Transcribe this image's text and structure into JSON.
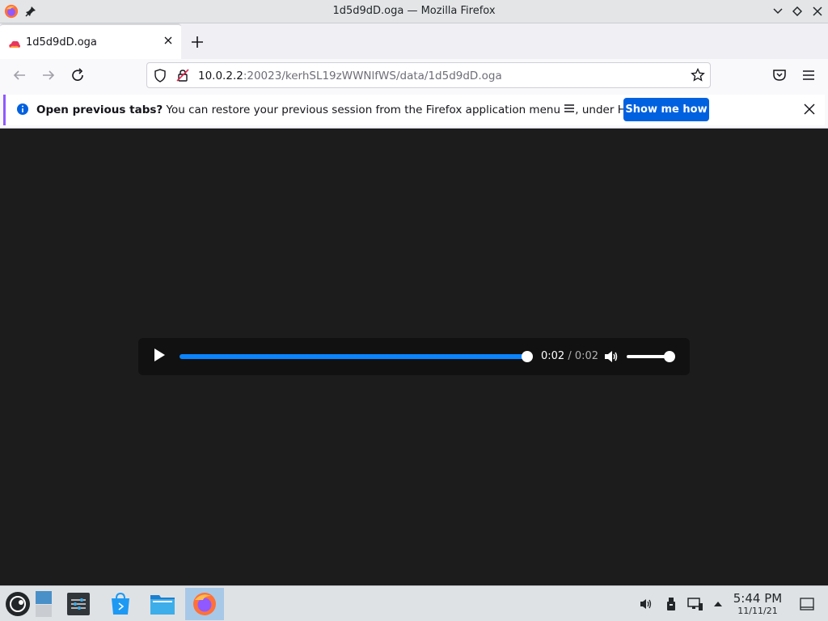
{
  "window": {
    "title": "1d5d9dD.oga — Mozilla Firefox"
  },
  "tabs": [
    {
      "label": "1d5d9dD.oga"
    }
  ],
  "navbar": {
    "url_host": "10.0.2.2",
    "url_rest": ":20023/kerhSL19zWWNlfWS/data/1d5d9dD.oga"
  },
  "notification": {
    "bold": "Open previous tabs?",
    "text": " You can restore your previous session from the Firefox application menu ",
    "text_after": ", under History.",
    "button": "Show me how"
  },
  "player": {
    "current_time": "0:02",
    "separator": " / ",
    "duration": "0:02",
    "progress_fraction": 1.0,
    "volume_fraction": 1.0
  },
  "taskbar": {
    "time": "5:44 PM",
    "date": "11/11/21"
  },
  "colors": {
    "accent": "#0a84ff",
    "button_blue": "#0061e0",
    "notification_bar": "#9059ff"
  }
}
